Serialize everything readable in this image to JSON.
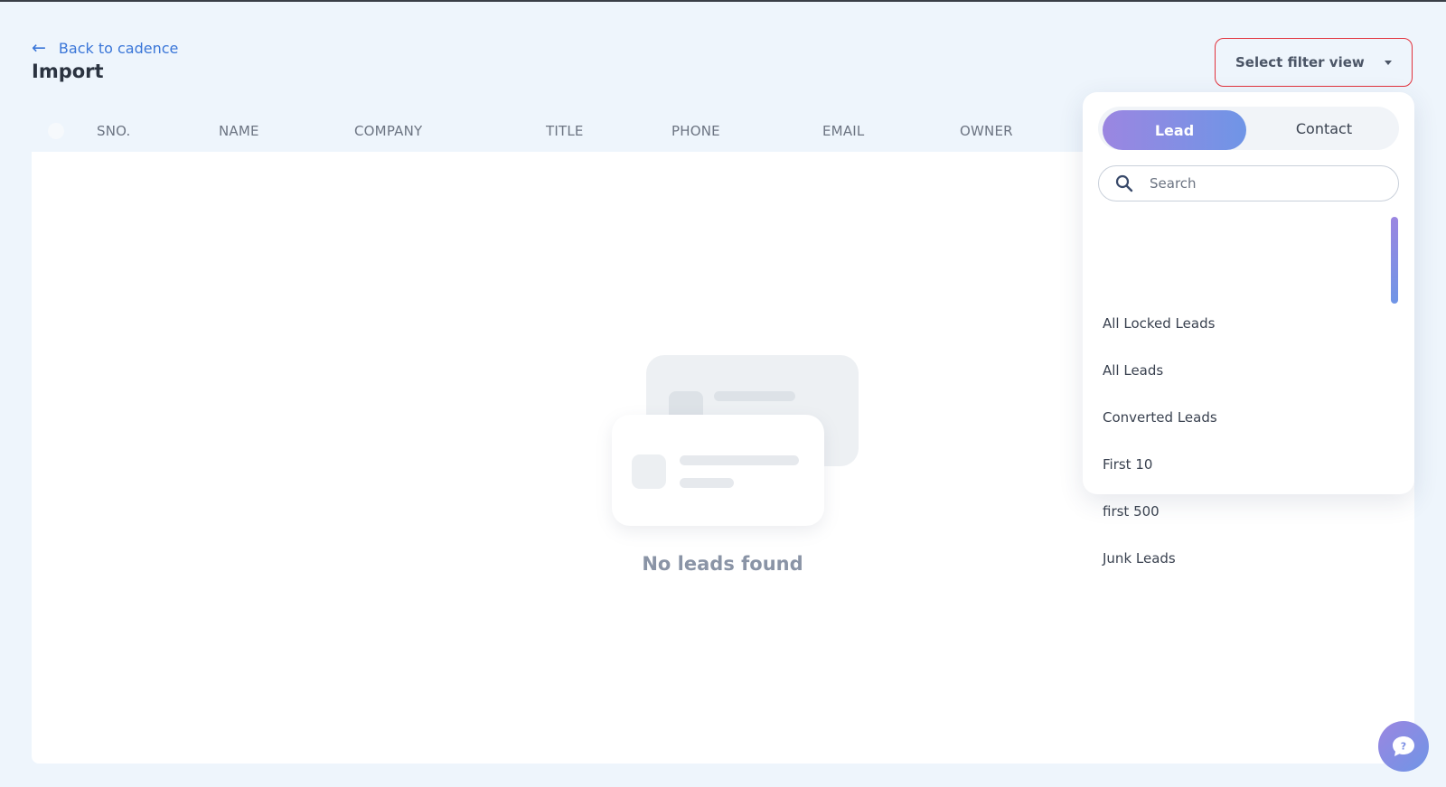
{
  "header": {
    "back_label": "Back to cadence",
    "title": "Import"
  },
  "filter": {
    "placeholder": "Select filter view"
  },
  "table": {
    "columns": [
      "SNO.",
      "NAME",
      "COMPANY",
      "TITLE",
      "PHONE",
      "EMAIL",
      "OWNER"
    ]
  },
  "empty_state": {
    "message": "No leads found"
  },
  "dropdown": {
    "tabs": [
      {
        "label": "Lead",
        "active": true
      },
      {
        "label": "Contact",
        "active": false
      }
    ],
    "search_placeholder": "Search",
    "options": [
      "All Locked Leads",
      "All Leads",
      "Converted Leads",
      "First 10",
      "first 500",
      "Junk Leads"
    ]
  },
  "colors": {
    "accent_gradient_start": "#9b86e1",
    "accent_gradient_end": "#6f95e6",
    "link": "#3a76d8",
    "select_border": "#e2323c",
    "background": "#eef5fc"
  },
  "icons": {
    "back": "arrow-left-icon",
    "select": "caret-down-icon",
    "search": "search-icon",
    "help": "chat-question-icon"
  }
}
